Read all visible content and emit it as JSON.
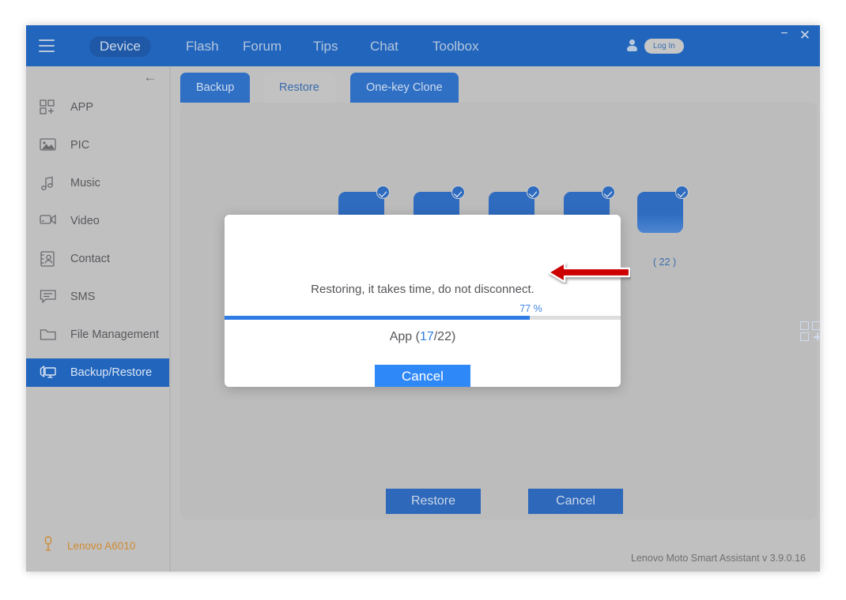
{
  "window": {
    "minimize_label": "−",
    "close_label": "✕"
  },
  "header": {
    "menu_icon": "hamburger-icon",
    "nav": [
      {
        "label": "Device",
        "active": true
      },
      {
        "label": "Flash",
        "active": false
      },
      {
        "label": "Forum",
        "active": false
      },
      {
        "label": "Tips",
        "active": false
      },
      {
        "label": "Chat",
        "active": false
      },
      {
        "label": "Toolbox",
        "active": false
      }
    ],
    "account_icon": "user-icon",
    "login_label": "Log In",
    "background_color": "#2265bd",
    "active_pill_color": "#1f58a6"
  },
  "sidebar": {
    "collapse_icon": "←",
    "items": [
      {
        "label": "APP",
        "icon": "app-grid-icon",
        "active": false
      },
      {
        "label": "PIC",
        "icon": "picture-icon",
        "active": false
      },
      {
        "label": "Music",
        "icon": "music-note-icon",
        "active": false
      },
      {
        "label": "Video",
        "icon": "video-camera-icon",
        "active": false
      },
      {
        "label": "Contact",
        "icon": "contact-card-icon",
        "active": false
      },
      {
        "label": "SMS",
        "icon": "message-lines-icon",
        "active": false
      },
      {
        "label": "File Management",
        "icon": "folder-icon",
        "active": false
      },
      {
        "label": "Backup/Restore",
        "icon": "backup-restore-icon",
        "active": true
      }
    ],
    "device": {
      "name": "Lenovo A6010",
      "icon": "usb-plug-icon",
      "color": "#d08a34"
    },
    "active_color": "#2265bd"
  },
  "main": {
    "tabs": [
      {
        "label": "Backup",
        "active": false
      },
      {
        "label": "Restore",
        "active": true
      },
      {
        "label": "One-key Clone",
        "active": false
      }
    ],
    "category_cards": [
      {
        "checked": true,
        "count": ""
      },
      {
        "checked": true,
        "count": ""
      },
      {
        "checked": true,
        "count": ""
      },
      {
        "checked": true,
        "count": ""
      },
      {
        "checked": true,
        "count": "( 22 )",
        "icon": "app-grid-icon"
      }
    ],
    "buttons": [
      {
        "label": "Restore"
      },
      {
        "label": "Cancel"
      }
    ],
    "footer_version": "Lenovo Moto Smart Assistant v 3.9.0.16"
  },
  "dialog": {
    "message": "Restoring, it takes time, do not disconnect.",
    "progress_percent": 77,
    "progress_percent_label": "77 %",
    "stage_prefix": "App (",
    "stage_current": "17",
    "stage_suffix": "/22)",
    "cancel_label": "Cancel",
    "accent_color": "#2f7ce4",
    "button_color": "#2f88f7"
  },
  "annotation": {
    "arrow": "left-arrow-annotation",
    "color": "#cc0000"
  }
}
